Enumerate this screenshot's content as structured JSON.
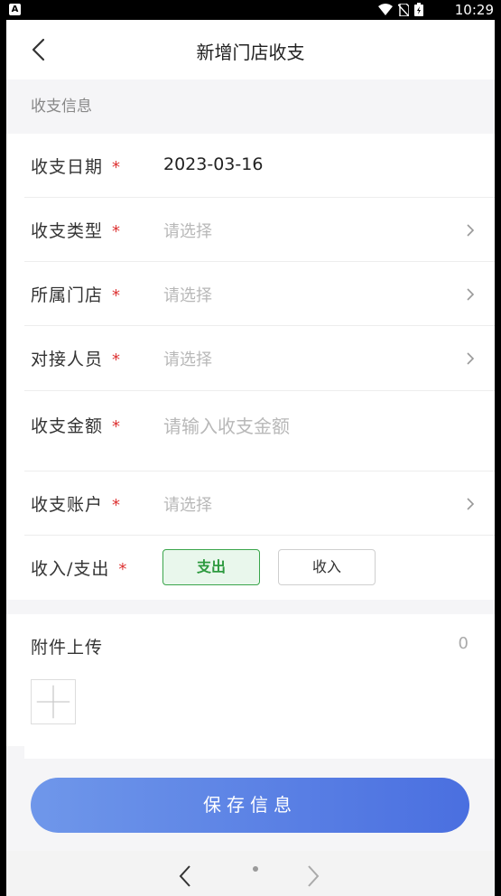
{
  "status_bar": {
    "time": "10:29"
  },
  "header": {
    "title": "新增门店收支"
  },
  "section": {
    "label": "收支信息"
  },
  "form": {
    "required_mark": "*",
    "date": {
      "label": "收支日期",
      "value": "2023-03-16"
    },
    "type": {
      "label": "收支类型",
      "placeholder": "请选择"
    },
    "store": {
      "label": "所属门店",
      "placeholder": "请选择"
    },
    "contact": {
      "label": "对接人员",
      "placeholder": "请选择"
    },
    "amount": {
      "label": "收支金额",
      "placeholder": "请输入收支金额"
    },
    "account": {
      "label": "收支账户",
      "placeholder": "请选择"
    },
    "direction": {
      "label": "收入/支出",
      "options": [
        "支出",
        "收入"
      ],
      "selected": "支出"
    }
  },
  "upload": {
    "label": "附件上传",
    "count": "0"
  },
  "actions": {
    "save_label": "保存信息"
  },
  "colors": {
    "primary_gradient_start": "#6f97ea",
    "primary_gradient_end": "#4a6fe0",
    "active_green": "#2d9a3f",
    "required_red": "#d33333"
  }
}
